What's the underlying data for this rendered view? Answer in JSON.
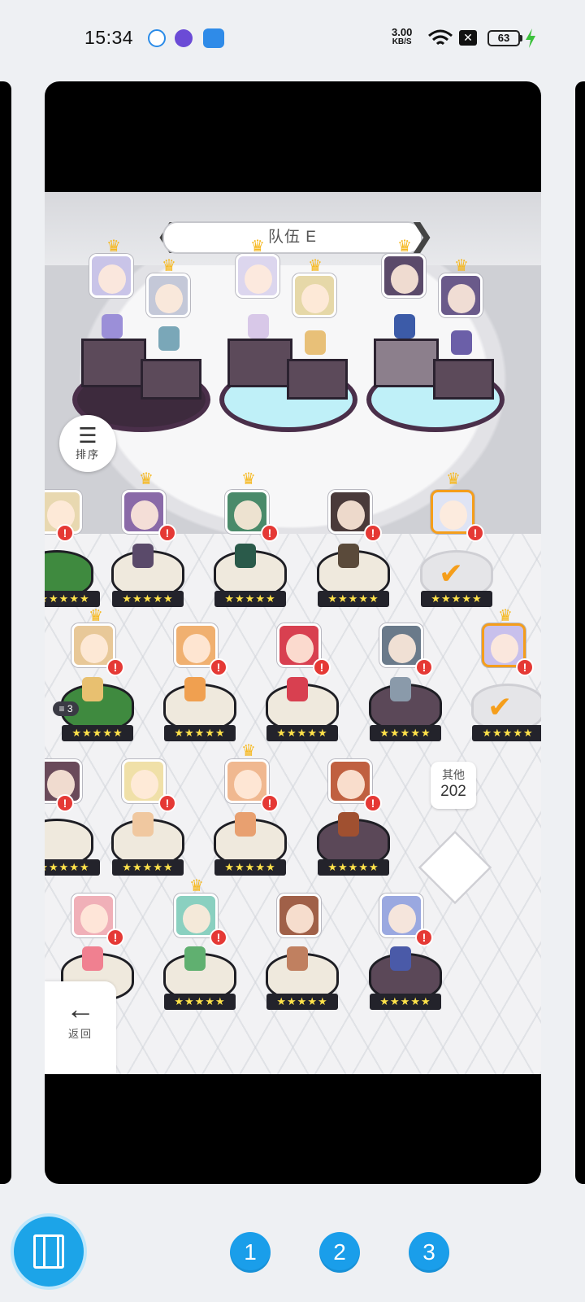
{
  "status_bar": {
    "time": "15:34",
    "net_speed_value": "3.00",
    "net_speed_unit": "KB/S",
    "battery": "63",
    "icons": [
      "search-app-icon",
      "record-app-icon",
      "assistant-app-icon",
      "wifi-icon",
      "sim-off-icon",
      "battery-icon",
      "charging-bolt-icon"
    ]
  },
  "game": {
    "team_title": "队伍 E",
    "sort_label": "排序",
    "back_label": "返回",
    "others_label": "其他",
    "others_count": "202",
    "stack_count": "3",
    "alert_mark": "!",
    "stars_text": "★★★★★",
    "colors": {
      "alert": "#e53935",
      "crown": "#f6b81f",
      "podium_water": "#bff0f8",
      "selected_check": "#f59e1b"
    }
  },
  "pagination": {
    "pages": [
      "1",
      "2",
      "3"
    ]
  },
  "app_icon": "app-switcher-icon"
}
